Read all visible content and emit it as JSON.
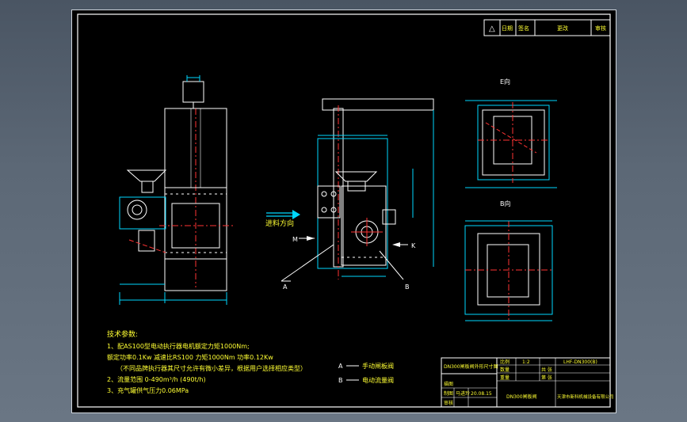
{
  "revision_table": {
    "symbol": "△",
    "date": "日期",
    "signature": "签名",
    "content": "更改",
    "audit": "审核"
  },
  "views": {
    "view_e_label": "E向",
    "view_b_label": "B向",
    "feed_direction": "进料方向",
    "arrow_m": "M",
    "arrow_k": "K",
    "leader_a": "A",
    "leader_b": "B"
  },
  "tech_params": {
    "heading": "技术参数:",
    "lines": [
      "1、配AS100型电动执行器电机额定力矩1000Nm;",
      "额定功率0.1Kw  减速比RS100  力矩1000Nm  功率0.12Kw",
      "（不同品牌执行器其尺寸允许有微小差异，根据用户选择相应类型）",
      "2、流量范围 0-490m³/h (490t/h)",
      "3、充气罐供气压力0.06MPa"
    ]
  },
  "legend": [
    {
      "key": "A",
      "text": "手动闸板阀"
    },
    {
      "key": "B",
      "text": "电动流量阀"
    }
  ],
  "title_block": {
    "drawing_title": "DN300闸板阀外形尺寸图",
    "scale_label": "比例",
    "scale_value": "1:2",
    "drawing_no": "LHF-DN300(B)",
    "quantity_label": "数量",
    "sheet_label": "共 张",
    "weight_label": "重量",
    "sheet_no_label": "第 张",
    "drawn_label": "制图",
    "drafter": "马进玲",
    "date": "20.08.15",
    "product_name": "DN300闸板阀",
    "company": "天津市新科机械设备有限公司",
    "check_label": "描图",
    "review_label": "审核"
  },
  "colors": {
    "sheet_bg": "#000000",
    "line_white": "#ffffff",
    "line_cyan": "#00d8ff",
    "line_red": "#ff3333",
    "text_yellow": "#ffff33",
    "line_green": "#33ff66"
  }
}
